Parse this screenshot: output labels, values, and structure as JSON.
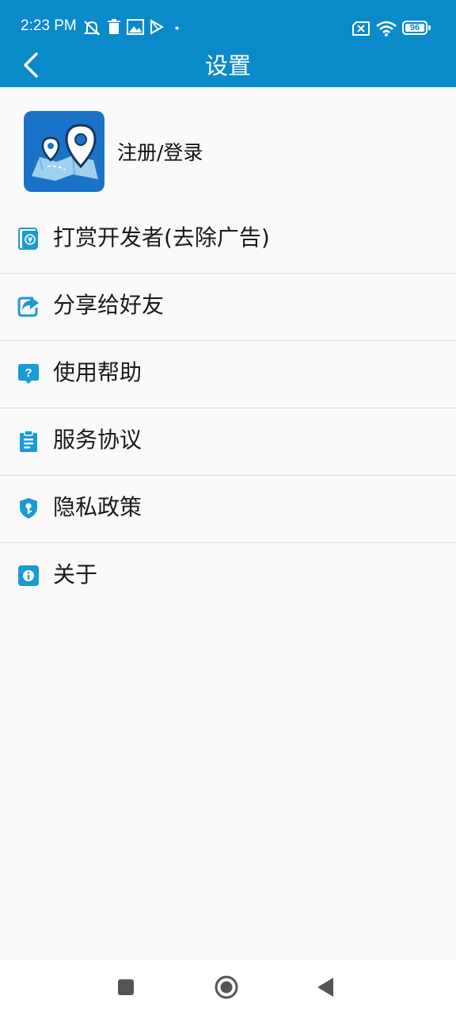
{
  "status_bar": {
    "time": "2:23 PM",
    "battery": "96",
    "icons": [
      "notifications-off-icon",
      "trash-icon",
      "gallery-icon",
      "play-store-icon",
      "dot-icon",
      "no-sim-icon",
      "wifi-icon",
      "battery-icon"
    ]
  },
  "header": {
    "title": "设置",
    "back_icon": "chevron-left-icon"
  },
  "account": {
    "label": "注册/登录",
    "logo_icon": "map-pin-logo-icon"
  },
  "menu": {
    "items": [
      {
        "label": "打赏开发者(去除广告)",
        "icon": "yuan-wallet-icon"
      },
      {
        "label": "分享给好友",
        "icon": "share-icon"
      },
      {
        "label": "使用帮助",
        "icon": "help-icon"
      },
      {
        "label": "服务协议",
        "icon": "clipboard-icon"
      },
      {
        "label": "隐私政策",
        "icon": "shield-key-icon"
      },
      {
        "label": "关于",
        "icon": "info-icon"
      }
    ]
  },
  "nav_bar": {
    "icons": [
      "recents-icon",
      "home-icon",
      "back-icon"
    ]
  },
  "colors": {
    "primary": "#0a8ac9",
    "icon_blue": "#1a9ad6",
    "background": "#fafafa",
    "divider": "#d9d9d9"
  }
}
